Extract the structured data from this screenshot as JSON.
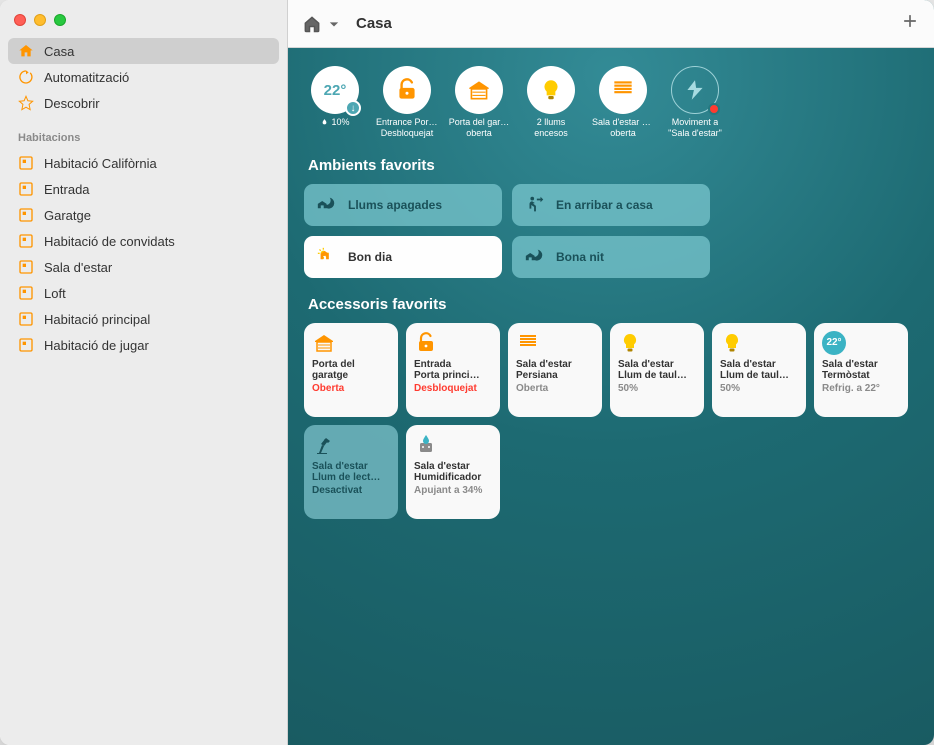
{
  "window": {
    "title": "Casa"
  },
  "sidebar": {
    "nav": [
      {
        "id": "home",
        "label": "Casa",
        "selected": true
      },
      {
        "id": "automation",
        "label": "Automatització",
        "selected": false
      },
      {
        "id": "discover",
        "label": "Descobrir",
        "selected": false
      }
    ],
    "rooms_header": "Habitacions",
    "rooms": [
      {
        "label": "Habitació Califòrnia"
      },
      {
        "label": "Entrada"
      },
      {
        "label": "Garatge"
      },
      {
        "label": "Habitació de convidats"
      },
      {
        "label": "Sala d'estar"
      },
      {
        "label": "Loft"
      },
      {
        "label": "Habitació principal"
      },
      {
        "label": "Habitació de jugar"
      }
    ]
  },
  "status": {
    "climate": {
      "temp": "22°",
      "humidity": "10%"
    },
    "items": [
      {
        "id": "lock",
        "line1": "Entrance Porta…",
        "line2": "Desbloquejat"
      },
      {
        "id": "garage",
        "line1": "Porta del gar…",
        "line2": "oberta"
      },
      {
        "id": "lights",
        "line1": "2 llums",
        "line2": "encesos"
      },
      {
        "id": "shade",
        "line1": "Sala d'estar Per…",
        "line2": "oberta"
      },
      {
        "id": "motion",
        "line1": "Moviment a",
        "line2": "\"Sala d'estar\"",
        "alert": true
      }
    ]
  },
  "sections": {
    "scenes": "Ambients favorits",
    "accessories": "Accessoris favorits"
  },
  "scenes": [
    {
      "id": "lights-off",
      "label": "Llums apagades",
      "active": false
    },
    {
      "id": "arrive",
      "label": "En arribar a casa",
      "active": false
    },
    {
      "id": "good-morning",
      "label": "Bon dia",
      "active": true
    },
    {
      "id": "good-night",
      "label": "Bona nit",
      "active": false
    }
  ],
  "accessories": [
    {
      "id": "garage",
      "room": "Porta del",
      "name": "garatge",
      "state": "Oberta",
      "stateClass": "red",
      "icon": "garage",
      "off": false
    },
    {
      "id": "lock",
      "room": "Entrada",
      "name": "Porta princi…",
      "state": "Desbloquejat",
      "stateClass": "red",
      "icon": "lock",
      "off": false
    },
    {
      "id": "shade",
      "room": "Sala d'estar",
      "name": "Persiana",
      "state": "Oberta",
      "stateClass": "gray",
      "icon": "shade",
      "off": false
    },
    {
      "id": "lamp1",
      "room": "Sala d'estar",
      "name": "Llum de taul…",
      "state": "50%",
      "stateClass": "gray",
      "icon": "bulb",
      "off": false
    },
    {
      "id": "lamp2",
      "room": "Sala d'estar",
      "name": "Llum de taul…",
      "state": "50%",
      "stateClass": "gray",
      "icon": "bulb",
      "off": false
    },
    {
      "id": "therm",
      "room": "Sala d'estar",
      "name": "Termòstat",
      "state": "Refrig. a 22°",
      "stateClass": "gray",
      "icon": "therm",
      "off": false,
      "badge": "22°"
    },
    {
      "id": "readlamp",
      "room": "Sala d'estar",
      "name": "Llum de lect…",
      "state": "Desactivat",
      "stateClass": "",
      "icon": "desklamp",
      "off": true
    },
    {
      "id": "humid",
      "room": "Sala d'estar",
      "name": "Humidificador",
      "state": "Apujant a 34%",
      "stateClass": "gray",
      "icon": "humid",
      "off": false
    }
  ],
  "colors": {
    "accent": "#ff9500",
    "bulb": "#ffcc00",
    "teal": "#3bb3c4"
  }
}
